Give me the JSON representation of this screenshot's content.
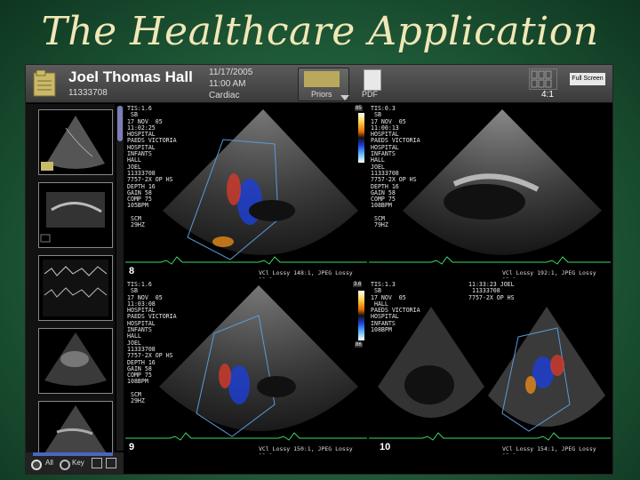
{
  "slide": {
    "title": "The Healthcare Application"
  },
  "header": {
    "patient_name": "Joel Thomas Hall",
    "patient_id": "11333708",
    "date": "11/17/2005",
    "time": "11:00 AM",
    "study_type": "Cardiac",
    "priors_label": "Priors",
    "pdf_label": "PDF",
    "layout_ratio": "4:1",
    "fullscreen_label": "Full Screen",
    "icons": [
      "folder-icon",
      "priors-icon",
      "pdf-icon",
      "layout-grid-icon"
    ]
  },
  "sidebar": {
    "thumbnails": [
      "thumbnail-1",
      "thumbnail-2",
      "thumbnail-3",
      "thumbnail-4",
      "thumbnail-5"
    ],
    "bottom": {
      "all_label": "All",
      "key_label": "Key"
    }
  },
  "panes": [
    {
      "overlay_left": "TIS:1.6\n SB\n17 NOV  05\n11:02:25\nHOSPITAL\nPAEDS VICTORIA\nHOSPITAL\nINFANTS\nHALL\nJOEL\n11333708\n7757-2X OP HS\nDEPTH 16\nGAIN 58\nCOMP 75\n105BPM\n\n SCM\n 29HZ",
      "compression": "VCl Lossy 148:1, JPEG Lossy 23:1",
      "number": "8",
      "colorbar_top": "85",
      "colorbar_bottom": "85"
    },
    {
      "overlay_left": "TIS:0.3\n SB\n17 NOV  05\n11:00:13\nHOSPITAL\nPAEDS VICTORIA\nHOSPITAL\nINFANTS\nHALL\nJOEL\n11333708\n7757-2X OP HS\nDEPTH 16\nGAIN 58\nCOMP 75\n108BPM\n\n SCM\n 79HZ",
      "compression": "VCl Lossy 192:1, JPEG Lossy 23:1",
      "number": "",
      "colorbar_top": "",
      "colorbar_bottom": ""
    },
    {
      "overlay_left": "TIS:1.6\n SB\n17 NOV  05\n11:03:08\nHOSPITAL\nPAEDS VICTORIA\nHOSPITAL\nINFANTS\nHALL\nJOEL\n11333708\n7757-2X OP HS\nDEPTH 16\nGAIN 58\nCOMP 75\n108BPM\n\n SCM\n 29HZ",
      "compression": "VCl Lossy 150:1, JPEG Lossy 23:1",
      "number": "9",
      "colorbar_top": "3.6",
      "colorbar_bottom": "86"
    },
    {
      "overlay_left": "TIS:1.3\n SB\n17 NOV  05\n HALL\nPAEDS VICTORIA\nHOSPITAL\nINFANTS\n108BPM",
      "overlay_right": "11:33:23 JOEL\n 11333708\n7757-2X OP HS",
      "compression": "VCl Lossy 154:1, JPEG Lossy 23:1",
      "number": "10",
      "colorbar_top": "",
      "colorbar_bottom": ""
    }
  ]
}
